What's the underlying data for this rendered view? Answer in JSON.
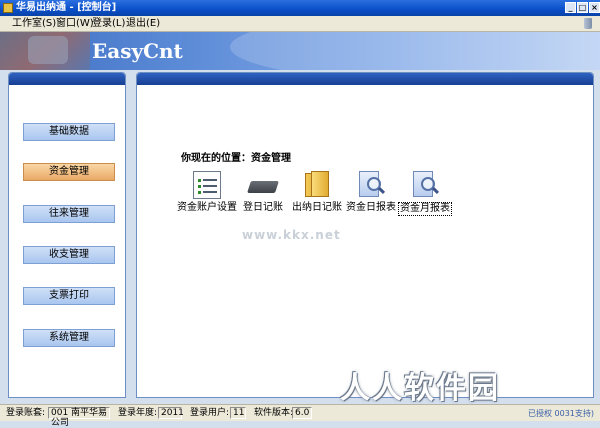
{
  "window": {
    "title": "华易出纳通 - [控制台]"
  },
  "menu": {
    "items": [
      "工作室(S)",
      "窗口(W)",
      "登录(L)",
      "退出(E)"
    ]
  },
  "banner": {
    "logo": "EasyCnt"
  },
  "sidebar": {
    "items": [
      {
        "label": "基础数据",
        "active": false
      },
      {
        "label": "资金管理",
        "active": true
      },
      {
        "label": "往来管理",
        "active": false
      },
      {
        "label": "收支管理",
        "active": false
      },
      {
        "label": "支票打印",
        "active": false
      },
      {
        "label": "系统管理",
        "active": false
      }
    ]
  },
  "main": {
    "location": "你现在的位置：资金管理",
    "functions": [
      {
        "label": "资金账户设置",
        "icon": "list-document-icon"
      },
      {
        "label": "登日记账",
        "icon": "keyboard-icon"
      },
      {
        "label": "出纳日记账",
        "icon": "folder-icon"
      },
      {
        "label": "资金日报表",
        "icon": "report-search-icon"
      },
      {
        "label": "资金月报表",
        "icon": "report-search-icon"
      }
    ]
  },
  "watermark": {
    "url": "www.kkx.net",
    "site": "人人软件园"
  },
  "status": {
    "account_label": "登录账套:",
    "account_value": "001 南平华易公司",
    "year_label": "登录年度:",
    "year_value": "2011",
    "user_label": "登录用户:",
    "user_value": "11",
    "version_label": "软件版本:",
    "version_value": "6.0",
    "right_text": "已授权 0031支持)"
  }
}
